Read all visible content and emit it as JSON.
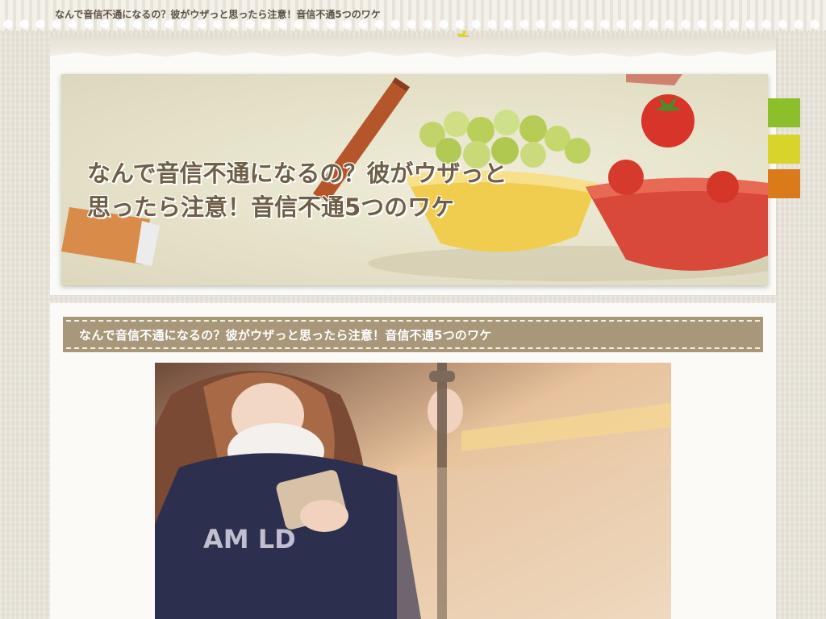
{
  "site": {
    "top_title": "なんで音信不通になるの？彼がウザっと思ったら注意！音信不通5つのワケ"
  },
  "banner": {
    "title_line1": "なんで音信不通になるの？彼がウザっと",
    "title_line2": "思ったら注意！音信不通5つのワケ"
  },
  "side_tabs": [
    {
      "color": "#8cbf2a"
    },
    {
      "color": "#d9d42a"
    },
    {
      "color": "#db7a1b"
    }
  ],
  "post": {
    "title": "なんで音信不通になるの？彼がウザっと思ったら注意！音信不通5つのワケ"
  }
}
